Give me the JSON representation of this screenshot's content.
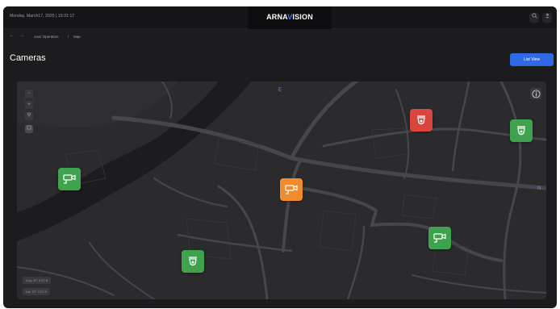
{
  "header": {
    "datetime": "Monday, March17, 2025 | 15:31:17",
    "logo_pre": "ARNA",
    "logo_accent": "V",
    "logo_post": "ISION",
    "accent_color": "#3b82f6"
  },
  "breadcrumb": {
    "items": [
      "User Operation",
      "Map"
    ],
    "separator": "/"
  },
  "page": {
    "title": "Cameras",
    "list_view_label": "List View"
  },
  "map": {
    "compass_top": "E",
    "compass_right": "N",
    "zoom_in": "+",
    "zoom_out": "−",
    "coords": {
      "lng": "Lng: 37° 0'27.9",
      "lat": "Lat: 37° 0'27.9"
    }
  },
  "cameras": [
    {
      "type": "bullet",
      "status": "normal",
      "color": "#3fa34d"
    },
    {
      "type": "bullet",
      "status": "warning",
      "color": "#f08c2e"
    },
    {
      "type": "bullet",
      "status": "normal",
      "color": "#3fa34d"
    },
    {
      "type": "dome",
      "status": "alarm",
      "color": "#d9453f"
    },
    {
      "type": "dome",
      "status": "normal",
      "color": "#3fa34d"
    },
    {
      "type": "dome",
      "status": "normal",
      "color": "#3fa34d"
    }
  ]
}
